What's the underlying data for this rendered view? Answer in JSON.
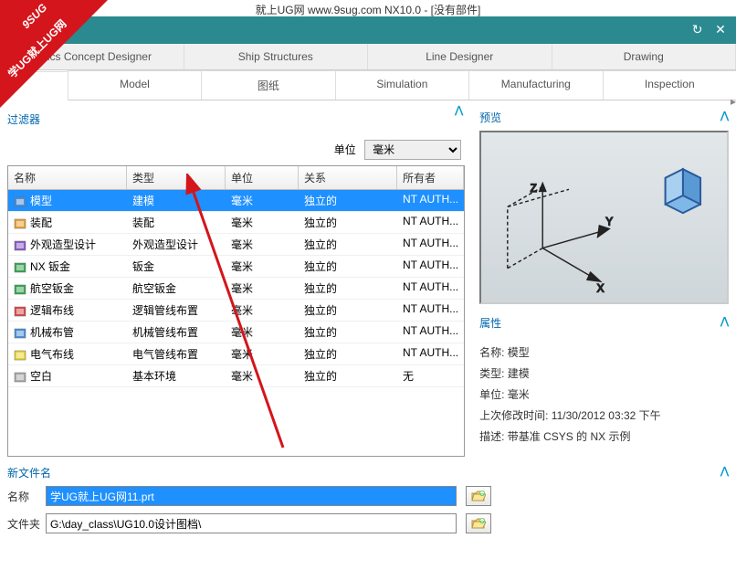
{
  "window": {
    "title": "就上UG网 www.9sug.com NX10.0 - [没有部件]"
  },
  "watermark": {
    "line1": "9SUG",
    "line2": "学UG就上UG网"
  },
  "tabs_primary": [
    "ronics Concept Designer",
    "Ship Structures",
    "Line Designer",
    "Drawing"
  ],
  "tabs_secondary": [
    "Model",
    "图纸",
    "Simulation",
    "Manufacturing",
    "Inspection"
  ],
  "filter_label": "过滤器",
  "unit_label": "单位",
  "unit_value": "毫米",
  "grid": {
    "headers": [
      "名称",
      "类型",
      "单位",
      "关系",
      "所有者"
    ],
    "rows": [
      {
        "name": "模型",
        "type": "建模",
        "unit": "毫米",
        "rel": "独立的",
        "owner": "NT AUTH...",
        "selected": true,
        "icon": "model"
      },
      {
        "name": "装配",
        "type": "装配",
        "unit": "毫米",
        "rel": "独立的",
        "owner": "NT AUTH...",
        "icon": "assembly"
      },
      {
        "name": "外观造型设计",
        "type": "外观造型设计",
        "unit": "毫米",
        "rel": "独立的",
        "owner": "NT AUTH...",
        "icon": "style"
      },
      {
        "name": "NX 钣金",
        "type": "钣金",
        "unit": "毫米",
        "rel": "独立的",
        "owner": "NT AUTH...",
        "icon": "sheet"
      },
      {
        "name": "航空钣金",
        "type": "航空钣金",
        "unit": "毫米",
        "rel": "独立的",
        "owner": "NT AUTH...",
        "icon": "aero"
      },
      {
        "name": "逻辑布线",
        "type": "逻辑管线布置",
        "unit": "毫米",
        "rel": "独立的",
        "owner": "NT AUTH...",
        "icon": "logic"
      },
      {
        "name": "机械布管",
        "type": "机械管线布置",
        "unit": "毫米",
        "rel": "独立的",
        "owner": "NT AUTH...",
        "icon": "mech"
      },
      {
        "name": "电气布线",
        "type": "电气管线布置",
        "unit": "毫米",
        "rel": "独立的",
        "owner": "NT AUTH...",
        "icon": "elec"
      },
      {
        "name": "空白",
        "type": "基本环境",
        "unit": "毫米",
        "rel": "独立的",
        "owner": "无",
        "icon": "blank"
      }
    ]
  },
  "preview": {
    "title": "预览",
    "axes": {
      "x": "X",
      "y": "Y",
      "z": "Z"
    }
  },
  "props": {
    "title": "属性",
    "items": [
      "名称:  模型",
      "类型:  建模",
      "单位:  毫米",
      "上次修改时间:  11/30/2012 03:32 下午",
      "描述:  带基准 CSYS 的 NX 示例"
    ]
  },
  "footer": {
    "title": "新文件名",
    "name_label": "名称",
    "name_value": "学UG就上UG网11.prt",
    "folder_label": "文件夹",
    "folder_value": "G:\\day_class\\UG10.0设计图档\\"
  },
  "caret_up": "⋀"
}
